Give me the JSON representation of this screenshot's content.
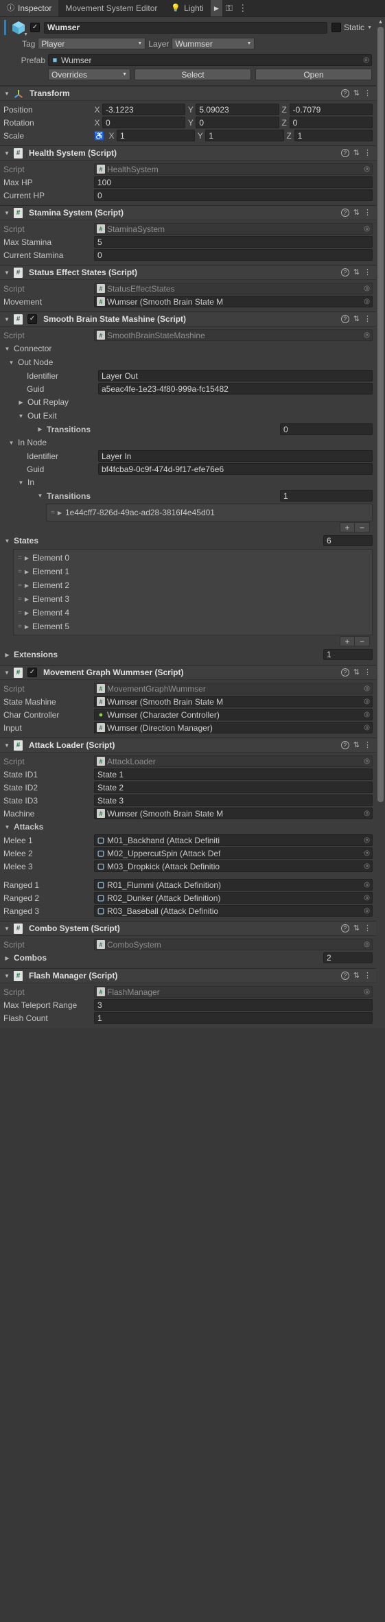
{
  "tabs": [
    {
      "label": "Inspector",
      "icon": "info-icon",
      "active": true
    },
    {
      "label": "Movement System Editor",
      "icon": "",
      "active": false
    },
    {
      "label": "Lighti",
      "icon": "lightbulb-icon",
      "active": false
    }
  ],
  "tabbar": {
    "more_glyph": "▶",
    "lock_glyph": "⚿",
    "menu_glyph": "⋮"
  },
  "gameobject": {
    "enabled_check": "✓",
    "name": "Wumser",
    "static_label": "Static",
    "tag_label": "Tag",
    "tag_value": "Player",
    "layer_label": "Layer",
    "layer_value": "Wummser",
    "prefab_label": "Prefab",
    "prefab_value": "Wumser",
    "overrides_label": "Overrides",
    "select_label": "Select",
    "open_label": "Open"
  },
  "transform": {
    "title": "Transform",
    "rows": [
      {
        "name": "Position",
        "x": "-3.1223",
        "y": "5.09023",
        "z": "-0.7079"
      },
      {
        "name": "Rotation",
        "x": "0",
        "y": "0",
        "z": "0"
      },
      {
        "name": "Scale",
        "x": "1",
        "y": "1",
        "z": "1"
      }
    ],
    "axis_x": "X",
    "axis_y": "Y",
    "axis_z": "Z"
  },
  "health_system": {
    "title": "Health System (Script)",
    "script_label": "Script",
    "script_value": "HealthSystem",
    "fields": [
      {
        "name": "Max HP",
        "value": "100"
      },
      {
        "name": "Current HP",
        "value": "0"
      }
    ]
  },
  "stamina_system": {
    "title": "Stamina System (Script)",
    "script_label": "Script",
    "script_value": "StaminaSystem",
    "fields": [
      {
        "name": "Max Stamina",
        "value": "5"
      },
      {
        "name": "Current Stamina",
        "value": "0"
      }
    ]
  },
  "status_effect_states": {
    "title": "Status Effect States (Script)",
    "script_label": "Script",
    "script_value": "StatusEffectStates",
    "movement_label": "Movement",
    "movement_value": "Wumser (Smooth Brain State M"
  },
  "smooth_brain": {
    "title": "Smooth Brain State Mashine (Script)",
    "enabled_check": "✓",
    "script_label": "Script",
    "script_value": "SmoothBrainStateMashine",
    "connector_label": "Connector",
    "out_node_label": "Out Node",
    "out_identifier_label": "Identifier",
    "out_identifier_value": "Layer Out",
    "out_guid_label": "Guid",
    "out_guid_value": "a5eac4fe-1e23-4f80-999a-fc15482",
    "out_replay_label": "Out Replay",
    "out_exit_label": "Out Exit",
    "out_transitions_label": "Transitions",
    "out_transitions_value": "0",
    "in_node_label": "In Node",
    "in_identifier_label": "Identifier",
    "in_identifier_value": "Layer In",
    "in_guid_label": "Guid",
    "in_guid_value": "bf4fcba9-0c9f-474d-9f17-efe76e6",
    "in_label": "In",
    "in_transitions_label": "Transitions",
    "in_transitions_value": "1",
    "in_transition_item": "1e44cff7-826d-49ac-ad28-3816f4e45d01",
    "plus": "+",
    "minus": "−",
    "states_label": "States",
    "states_count": "6",
    "state_elements": [
      "Element 0",
      "Element 1",
      "Element 2",
      "Element 3",
      "Element 4",
      "Element 5"
    ],
    "extensions_label": "Extensions",
    "extensions_count": "1"
  },
  "movement_graph": {
    "title": "Movement Graph Wummser (Script)",
    "enabled_check": "✓",
    "rows": [
      {
        "name": "Script",
        "value": "MovementGraphWummser",
        "dim": true,
        "icon": "script-icon"
      },
      {
        "name": "State Mashine",
        "value": "Wumser (Smooth Brain State M",
        "dim": false,
        "icon": "script-icon"
      },
      {
        "name": "Char Controller",
        "value": "Wumser (Character Controller)",
        "dim": false,
        "icon": "character-controller-icon"
      },
      {
        "name": "Input",
        "value": "Wumser (Direction Manager)",
        "dim": false,
        "icon": "script-icon"
      }
    ]
  },
  "attack_loader": {
    "title": "Attack Loader (Script)",
    "rows": [
      {
        "name": "Script",
        "value": "AttackLoader",
        "dim": true,
        "icon": "script-icon"
      },
      {
        "name": "State ID1",
        "value": "State 1",
        "type": "text"
      },
      {
        "name": "State ID2",
        "value": "State 2",
        "type": "text"
      },
      {
        "name": "State ID3",
        "value": "State 3",
        "type": "text"
      },
      {
        "name": "Machine",
        "value": "Wumser (Smooth Brain State M",
        "dim": false,
        "icon": "script-icon"
      }
    ],
    "attacks_label": "Attacks",
    "attacks": [
      {
        "name": "Melee 1",
        "value": "M01_Backhand (Attack Definiti"
      },
      {
        "name": "Melee 2",
        "value": "M02_UppercutSpin (Attack Def"
      },
      {
        "name": "Melee 3",
        "value": "M03_Dropkick (Attack Definitio"
      },
      {
        "name": "Ranged 1",
        "value": "R01_Flummi (Attack Definition)"
      },
      {
        "name": "Ranged 2",
        "value": "R02_Dunker (Attack Definition)"
      },
      {
        "name": "Ranged 3",
        "value": "R03_Baseball (Attack Definitio"
      }
    ]
  },
  "combo_system": {
    "title": "Combo System (Script)",
    "script_label": "Script",
    "script_value": "ComboSystem",
    "combos_label": "Combos",
    "combos_count": "2"
  },
  "flash_manager": {
    "title": "Flash Manager (Script)",
    "script_label": "Script",
    "script_value": "FlashManager",
    "fields": [
      {
        "name": "Max Teleport Range",
        "value": "3"
      },
      {
        "name": "Flash Count",
        "value": "1"
      }
    ]
  },
  "icons": {
    "help": "?",
    "preset": "⇅",
    "menu": "⋮",
    "hash": "#",
    "dot": "◉",
    "arrow_down": "▼",
    "arrow_right": "▶",
    "scroll_up": "▲",
    "scroll_down": "▼"
  }
}
